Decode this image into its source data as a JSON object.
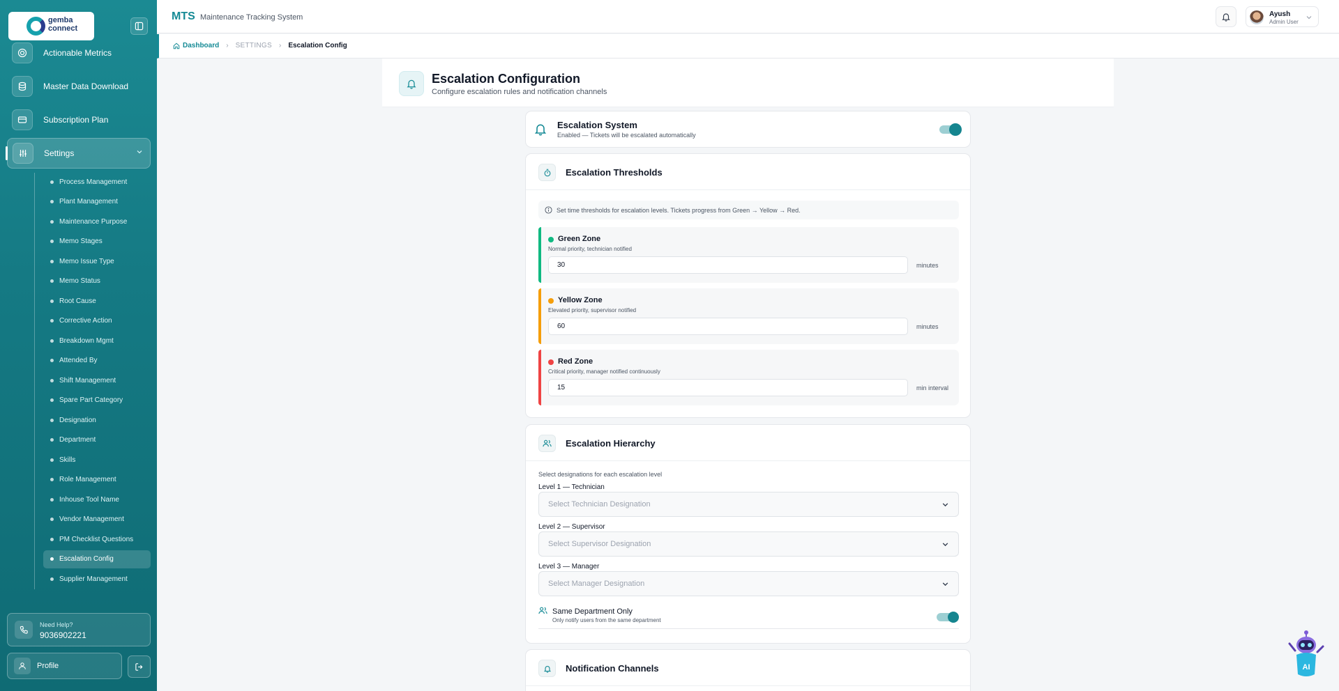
{
  "sidebar": {
    "logo_line1": "gemba",
    "logo_line2": "connect",
    "nav_items": [
      {
        "label": "Actionable Metrics",
        "icon": "target-icon"
      },
      {
        "label": "Master Data Download",
        "icon": "database-icon"
      },
      {
        "label": "Subscription Plan",
        "icon": "credit-card-icon"
      },
      {
        "label": "Settings",
        "icon": "sliders-icon"
      }
    ],
    "sub_items": [
      "Process Management",
      "Plant Management",
      "Maintenance Purpose",
      "Memo Stages",
      "Memo Issue Type",
      "Memo Status",
      "Root Cause",
      "Corrective Action",
      "Breakdown Mgmt",
      "Attended By",
      "Shift Management",
      "Spare Part Category",
      "Designation",
      "Department",
      "Skills",
      "Role Management",
      "Inhouse Tool Name",
      "Vendor Management",
      "PM Checklist Questions",
      "Escalation Config",
      "Supplier Management"
    ],
    "help_label": "Need Help?",
    "help_phone": "9036902221",
    "profile_label": "Profile"
  },
  "header": {
    "app_code": "MTS",
    "app_title": "Maintenance Tracking System",
    "user_name": "Ayush",
    "user_role": "Admin User"
  },
  "breadcrumb": {
    "home": "Dashboard",
    "section": "SETTINGS",
    "current": "Escalation Config"
  },
  "page": {
    "title": "Escalation Configuration",
    "subtitle": "Configure escalation rules and notification channels"
  },
  "system": {
    "title": "Escalation System",
    "status": "Enabled — Tickets will be escalated automatically",
    "enabled": true
  },
  "thresholds": {
    "title": "Escalation Thresholds",
    "info": "Set time thresholds for escalation levels. Tickets progress from Green → Yellow → Red.",
    "zones": [
      {
        "name": "Green Zone",
        "desc": "Normal priority, technician notified",
        "value": "30",
        "unit": "minutes",
        "color": "#10b981"
      },
      {
        "name": "Yellow Zone",
        "desc": "Elevated priority, supervisor notified",
        "value": "60",
        "unit": "minutes",
        "color": "#f59e0b"
      },
      {
        "name": "Red Zone",
        "desc": "Critical priority, manager notified continuously",
        "value": "15",
        "unit": "min interval",
        "color": "#ef4444"
      }
    ]
  },
  "hierarchy": {
    "title": "Escalation Hierarchy",
    "subtitle": "Select designations for each escalation level",
    "levels": [
      {
        "label": "Level 1 — Technician",
        "placeholder": "Select Technician Designation"
      },
      {
        "label": "Level 2 — Supervisor",
        "placeholder": "Select Supervisor Designation"
      },
      {
        "label": "Level 3 — Manager",
        "placeholder": "Select Manager Designation"
      }
    ],
    "same_dept_title": "Same Department Only",
    "same_dept_sub": "Only notify users from the same department",
    "same_dept_enabled": true
  },
  "notifications": {
    "title": "Notification Channels"
  },
  "colors": {
    "brand": "#158a95",
    "sidebar": "#157a84"
  }
}
